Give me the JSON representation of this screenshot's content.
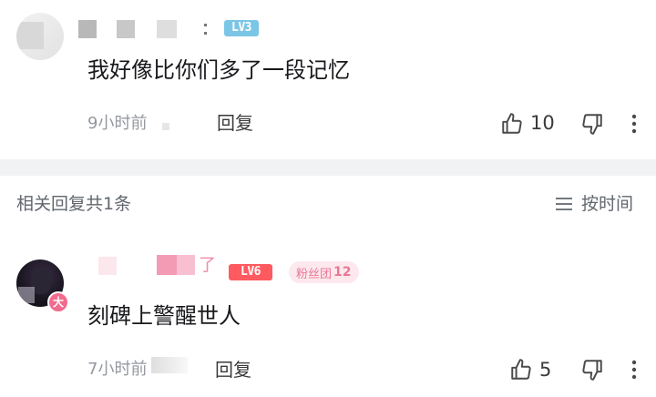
{
  "comment": {
    "level_badge": "LV3",
    "text": "我好像比你们多了一段记忆",
    "time": "9小时前",
    "reply_label": "回复",
    "like_count": "10"
  },
  "replies_header": {
    "title": "相关回复共1条",
    "sort_label": "按时间"
  },
  "reply": {
    "username_visible_char": "了",
    "level_badge": "LV6",
    "fan_badge_label": "粉丝团",
    "fan_badge_level": "12",
    "avatar_badge": "大",
    "text": "刻碑上警醒世人",
    "time": "7小时前",
    "reply_label": "回复",
    "like_count": "5"
  },
  "colors": {
    "lv3": "#7bc6e6",
    "lv6": "#ff5a5f",
    "fan_badge_bg": "#fde8ee",
    "fan_badge_text": "#e87896",
    "divider": "#f1f2f3",
    "secondary_text": "#9499a0"
  },
  "icons": {
    "like": "thumbs-up-icon",
    "dislike": "thumbs-down-icon",
    "more": "more-vertical-icon",
    "sort": "menu-lines-icon"
  }
}
